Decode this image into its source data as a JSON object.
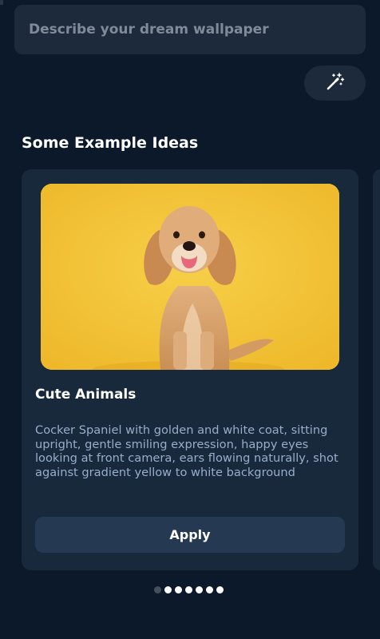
{
  "prompt": {
    "placeholder": "Describe your dream wallpaper",
    "value": ""
  },
  "magic_button": {
    "icon": "magic-wand-icon"
  },
  "section": {
    "title": "Some Example Ideas"
  },
  "cards": [
    {
      "image": "cocker-spaniel-photo",
      "title": "Cute Animals",
      "description": "Cocker Spaniel with golden and white coat, sitting upright, gentle smiling expression, happy eyes looking at front camera, ears flowing naturally, shot against gradient yellow to white background",
      "button_label": "Apply"
    }
  ],
  "pagination": {
    "total": 7,
    "active_index": 0
  },
  "colors": {
    "background": "#0c192b",
    "surface": "#1d2a3b",
    "card": "#17293b",
    "button": "#253a52",
    "description_text": "#97adca",
    "image_backdrop": "#f3c02f"
  }
}
